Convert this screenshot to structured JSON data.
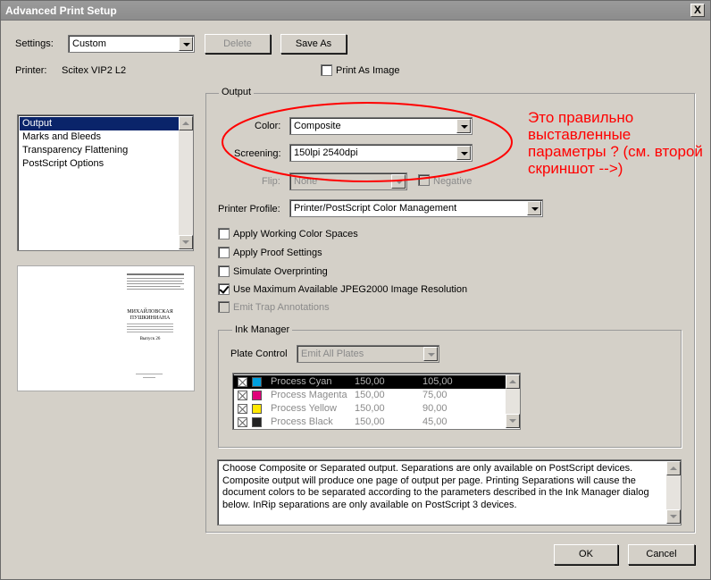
{
  "window": {
    "title": "Advanced Print Setup",
    "close_glyph": "X"
  },
  "settings": {
    "label": "Settings:",
    "value": "Custom",
    "delete_label": "Delete",
    "saveas_label": "Save As"
  },
  "printer": {
    "label": "Printer:",
    "name": "Scitex VIP2 L2",
    "print_as_image_label": "Print As Image"
  },
  "sidebar": {
    "items": [
      {
        "label": "Output",
        "selected": true
      },
      {
        "label": "Marks and Bleeds"
      },
      {
        "label": "Transparency Flattening"
      },
      {
        "label": "PostScript Options"
      }
    ]
  },
  "preview": {
    "heading": "МИХАЙЛОВСКАЯ ПУШКИНИАНА",
    "issue": "Выпуск 26"
  },
  "output": {
    "group_title": "Output",
    "color_label": "Color:",
    "color_value": "Composite",
    "screening_label": "Screening:",
    "screening_value": "150lpi 2540dpi",
    "flip_label": "Flip:",
    "flip_value": "None",
    "negative_label": "Negative",
    "profile_label": "Printer Profile:",
    "profile_value": "Printer/PostScript Color Management",
    "checkboxes": [
      {
        "label": "Apply Working Color Spaces",
        "checked": false,
        "enabled": true
      },
      {
        "label": "Apply Proof Settings",
        "checked": false,
        "enabled": true
      },
      {
        "label": "Simulate Overprinting",
        "checked": false,
        "enabled": true
      },
      {
        "label": "Use Maximum Available JPEG2000 Image Resolution",
        "checked": true,
        "enabled": true
      },
      {
        "label": "Emit Trap Annotations",
        "checked": false,
        "enabled": false
      }
    ]
  },
  "ink_manager": {
    "group_title": "Ink Manager",
    "plate_control_label": "Plate Control",
    "plate_control_value": "Emit All Plates",
    "rows": [
      {
        "name": "Process Cyan",
        "lpi": "150,00",
        "angle": "105,00",
        "color": "#00a0e0",
        "selected": true
      },
      {
        "name": "Process Magenta",
        "lpi": "150,00",
        "angle": "75,00",
        "color": "#e0007a",
        "selected": false
      },
      {
        "name": "Process Yellow",
        "lpi": "150,00",
        "angle": "90,00",
        "color": "#ffe800",
        "selected": false
      },
      {
        "name": "Process Black",
        "lpi": "150,00",
        "angle": "45,00",
        "color": "#222222",
        "selected": false
      }
    ]
  },
  "description": {
    "lines": [
      "Choose Composite or Separated output. Separations are only available on PostScript devices.",
      "Composite output will produce one page of output per page. Printing Separations will cause the",
      "document colors to be separated according to the parameters described in the Ink Manager dialog",
      "below. InRip separations are only available on PostScript 3 devices."
    ]
  },
  "buttons": {
    "ok": "OK",
    "cancel": "Cancel"
  },
  "annotation": {
    "text": "Это правильно выставленные параметры ? (см. второй скриншот -->)",
    "color": "#ff0000"
  }
}
